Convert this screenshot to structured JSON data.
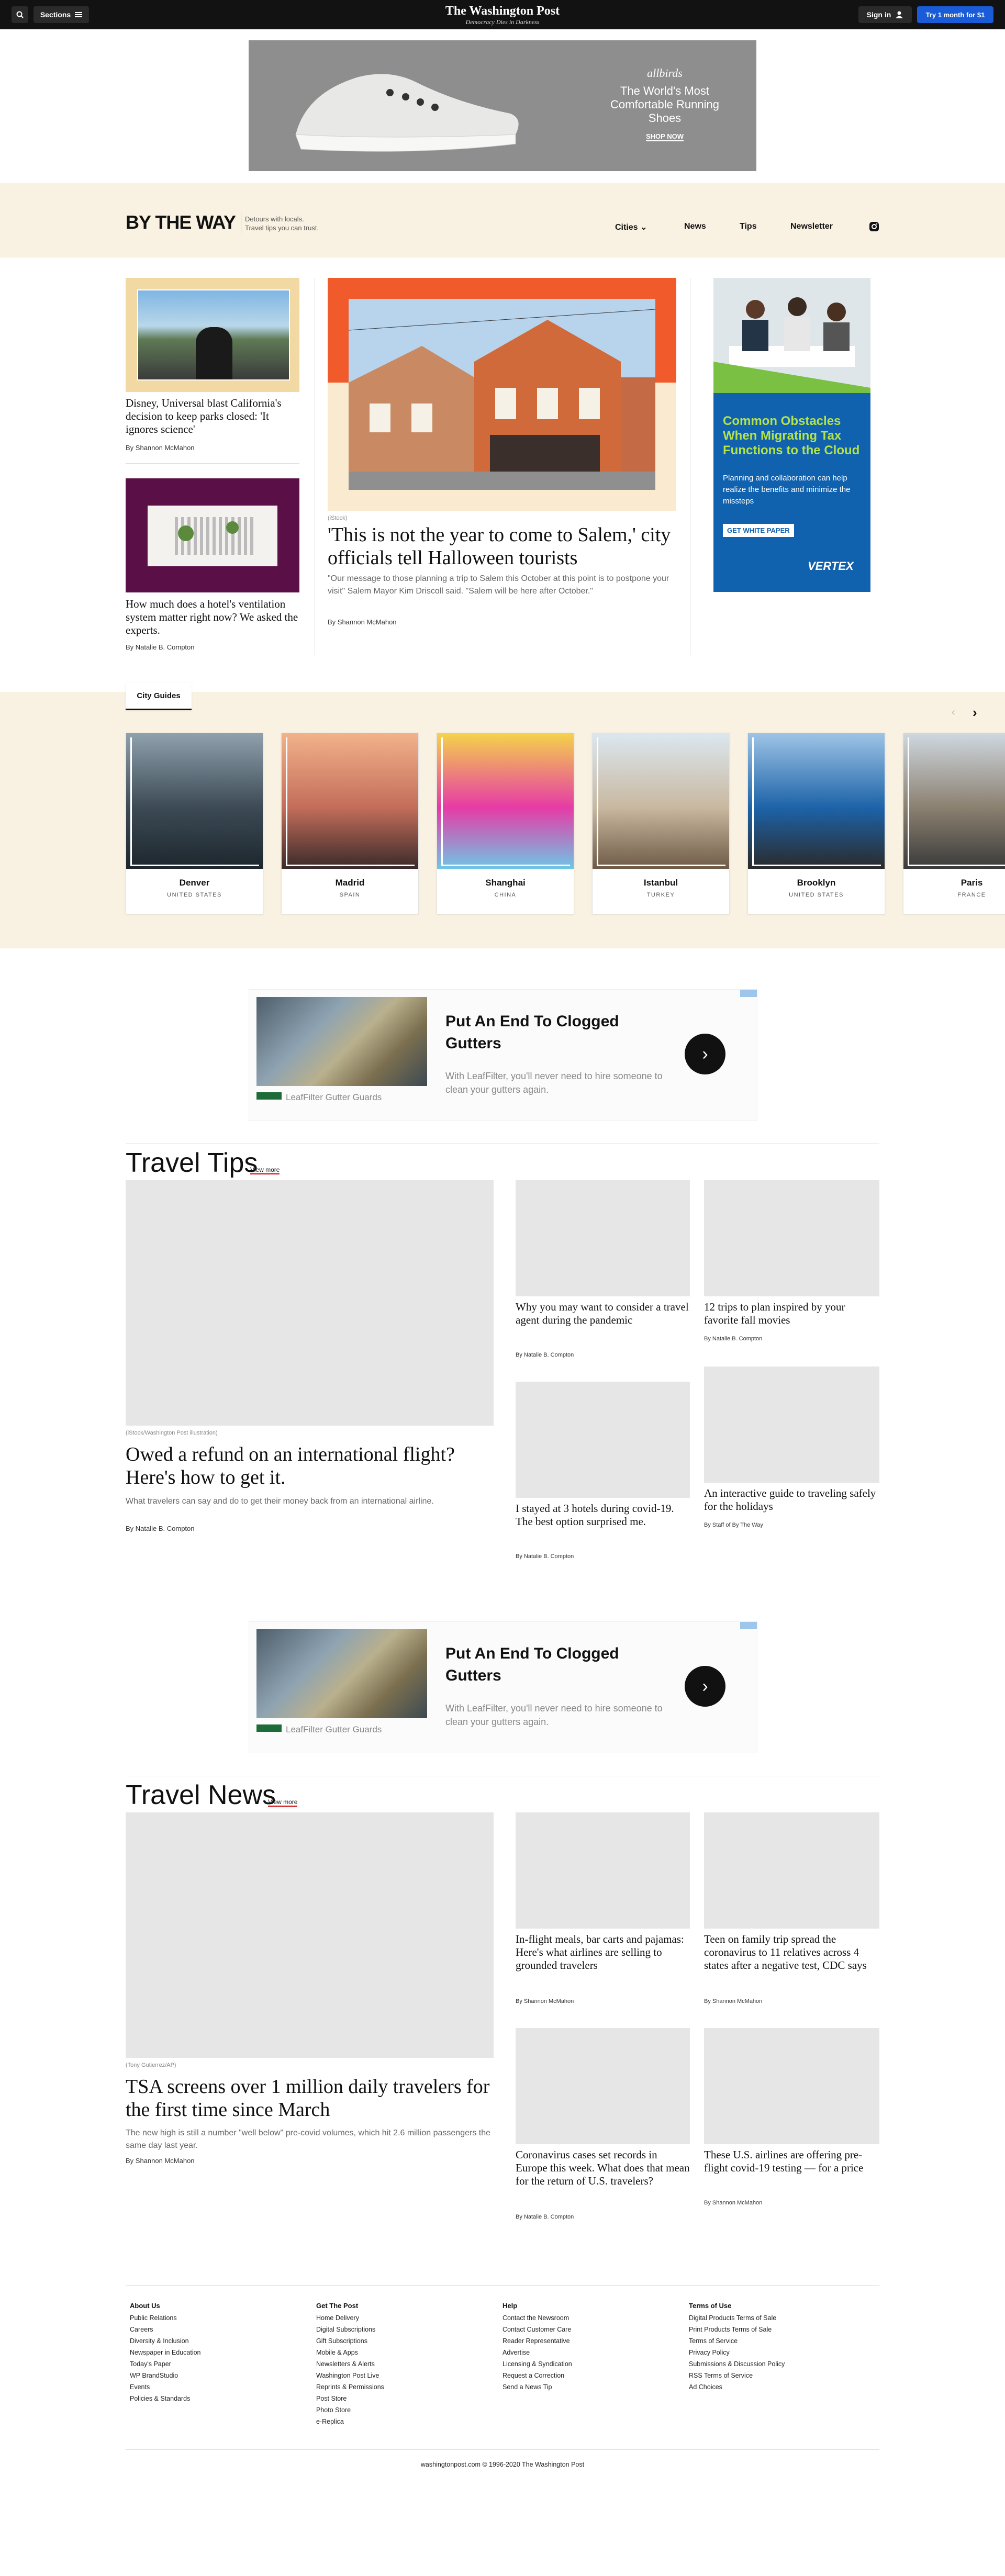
{
  "topnav": {
    "sections_label": "Sections",
    "logo_title": "The Washington Post",
    "logo_tagline": "Democracy Dies in Darkness",
    "signin_label": "Sign in",
    "subscribe_label": "Try 1 month for $1"
  },
  "ad_top": {
    "brand": "allbirds",
    "headline_line1": "The World's Most",
    "headline_line2": "Comfortable Running Shoes",
    "cta": "SHOP NOW"
  },
  "btw": {
    "logo": "BY THE WAY",
    "tagline_line1": "Detours with locals.",
    "tagline_line2": "Travel tips you can trust.",
    "menu": [
      "Cities",
      "News",
      "Tips",
      "Newsletter"
    ]
  },
  "hero": {
    "left_story1": {
      "headline": "Disney, Universal blast California's decision to keep parks closed: 'It ignores science'",
      "byline": "By Shannon McMahon"
    },
    "left_story2": {
      "headline": "How much does a hotel's ventilation system matter right now? We asked the experts.",
      "byline": "By Natalie B. Compton"
    },
    "main": {
      "credit": "(iStock)",
      "headline": "'This is not the year to come to Salem,' city officials tell Halloween tourists",
      "summary": "\"Our message to those planning a trip to Salem this October at this point is to postpone your visit\" Salem Mayor Kim Driscoll said. \"Salem will be here after October.\"",
      "byline": "By Shannon McMahon"
    },
    "ad_side": {
      "headline": "Common Obstacles When Migrating Tax Functions to the Cloud",
      "body": "Planning and collaboration can help realize the benefits and minimize the missteps",
      "cta": "GET WHITE PAPER",
      "brand": "VERTEX"
    }
  },
  "city_guides": {
    "tab_label": "City Guides",
    "cities": [
      {
        "name": "Denver",
        "country": "UNITED STATES"
      },
      {
        "name": "Madrid",
        "country": "SPAIN"
      },
      {
        "name": "Shanghai",
        "country": "CHINA"
      },
      {
        "name": "Istanbul",
        "country": "TURKEY"
      },
      {
        "name": "Brooklyn",
        "country": "UNITED STATES"
      },
      {
        "name": "Paris",
        "country": "FRANCE"
      }
    ]
  },
  "ad_mid": {
    "headline_line1": "Put An End To Clogged",
    "headline_line2": "Gutters",
    "body": "With LeafFilter, you'll never need to hire someone to clean your gutters again.",
    "brand": "LeafFilter Gutter Guards"
  },
  "travel_tips": {
    "title": "Travel Tips",
    "view_more": "View more",
    "main": {
      "credit": "(iStock/Washington Post illustration)",
      "headline": "Owed a refund on an international flight? Here's how to get it.",
      "summary": "What travelers can say and do to get their money back from an international airline.",
      "byline": "By Natalie B. Compton"
    },
    "items": [
      {
        "headline": "Why you may want to consider a travel agent during the pandemic",
        "byline": "By Natalie B. Compton"
      },
      {
        "headline": "12 trips to plan inspired by your favorite fall movies",
        "byline": "By Natalie B. Compton"
      },
      {
        "headline": "I stayed at 3 hotels during covid-19. The best option surprised me.",
        "byline": "By Natalie B. Compton"
      },
      {
        "headline": "An interactive guide to traveling safely for the holidays",
        "byline": "By Staff of By The Way"
      }
    ]
  },
  "travel_news": {
    "title": "Travel News",
    "view_more": "View more",
    "main": {
      "credit": "(Tony Gutierrez/AP)",
      "headline": "TSA screens over 1 million daily travelers for the first time since March",
      "summary": "The new high is still a number \"well below\" pre-covid volumes, which hit 2.6 million passengers the same day last year.",
      "byline": "By Shannon McMahon"
    },
    "items": [
      {
        "headline": "In-flight meals, bar carts and pajamas: Here's what airlines are selling to grounded travelers",
        "byline": "By Shannon McMahon"
      },
      {
        "headline": "Teen on family trip spread the coronavirus to 11 relatives across 4 states after a negative test, CDC says",
        "byline": "By Shannon McMahon"
      },
      {
        "headline": "Coronavirus cases set records in Europe this week. What does that mean for the return of U.S. travelers?",
        "byline": "By Natalie B. Compton"
      },
      {
        "headline": "These U.S. airlines are offering pre-flight covid-19 testing — for a price",
        "byline": "By Shannon McMahon"
      }
    ]
  },
  "footer": {
    "columns": [
      {
        "title": "About Us",
        "links": [
          "Public Relations",
          "Careers",
          "Diversity & Inclusion",
          "Newspaper in Education",
          "Today's Paper",
          "WP BrandStudio",
          "Events",
          "Policies & Standards"
        ]
      },
      {
        "title": "Get The Post",
        "links": [
          "Home Delivery",
          "Digital Subscriptions",
          "Gift Subscriptions",
          "Mobile & Apps",
          "Newsletters & Alerts",
          "Washington Post Live",
          "Reprints & Permissions",
          "Post Store",
          "Photo Store",
          "e-Replica"
        ]
      },
      {
        "title": "Help",
        "links": [
          "Contact the Newsroom",
          "Contact Customer Care",
          "Reader Representative",
          "Advertise",
          "Licensing & Syndication",
          "Request a Correction",
          "Send a News Tip"
        ]
      },
      {
        "title": "Terms of Use",
        "links": [
          "Digital Products Terms of Sale",
          "Print Products Terms of Sale",
          "Terms of Service",
          "Privacy Policy",
          "Submissions & Discussion Policy",
          "RSS Terms of Service",
          "Ad Choices"
        ]
      }
    ],
    "copyright": "washingtonpost.com © 1996-2020 The Washington Post"
  }
}
